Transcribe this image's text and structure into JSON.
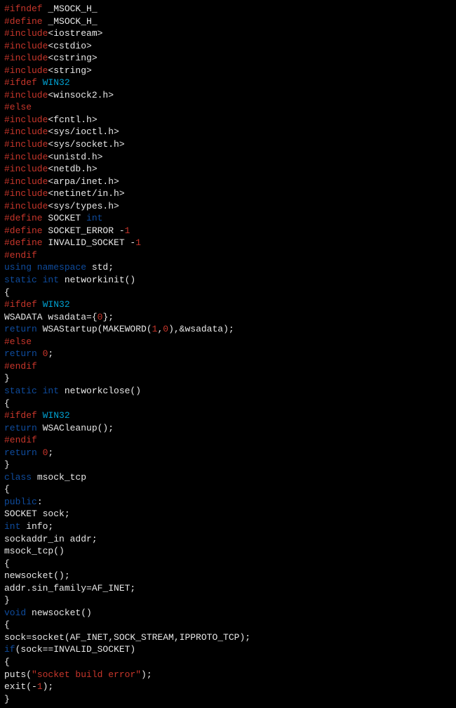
{
  "code": [
    {
      "tokens": [
        {
          "cls": "preproc",
          "t": "#ifndef"
        },
        {
          "cls": "white",
          "t": " _MSOCK_H_"
        }
      ]
    },
    {
      "tokens": [
        {
          "cls": "preproc",
          "t": "#define"
        },
        {
          "cls": "white",
          "t": " _MSOCK_H_"
        }
      ]
    },
    {
      "tokens": [
        {
          "cls": "preproc",
          "t": "#include"
        },
        {
          "cls": "white",
          "t": "<iostream>"
        }
      ]
    },
    {
      "tokens": [
        {
          "cls": "preproc",
          "t": "#include"
        },
        {
          "cls": "white",
          "t": "<cstdio>"
        }
      ]
    },
    {
      "tokens": [
        {
          "cls": "preproc",
          "t": "#include"
        },
        {
          "cls": "white",
          "t": "<cstring>"
        }
      ]
    },
    {
      "tokens": [
        {
          "cls": "preproc",
          "t": "#include"
        },
        {
          "cls": "white",
          "t": "<string>"
        }
      ]
    },
    {
      "tokens": [
        {
          "cls": "preproc",
          "t": "#ifdef"
        },
        {
          "cls": "cyan",
          "t": " WIN32"
        }
      ]
    },
    {
      "tokens": [
        {
          "cls": "preproc",
          "t": "#include"
        },
        {
          "cls": "white",
          "t": "<winsock2.h>"
        }
      ]
    },
    {
      "tokens": [
        {
          "cls": "preproc",
          "t": "#else"
        }
      ]
    },
    {
      "tokens": [
        {
          "cls": "preproc",
          "t": "#include"
        },
        {
          "cls": "white",
          "t": "<fcntl.h>"
        }
      ]
    },
    {
      "tokens": [
        {
          "cls": "preproc",
          "t": "#include"
        },
        {
          "cls": "white",
          "t": "<sys/ioctl.h>"
        }
      ]
    },
    {
      "tokens": [
        {
          "cls": "preproc",
          "t": "#include"
        },
        {
          "cls": "white",
          "t": "<sys/socket.h>"
        }
      ]
    },
    {
      "tokens": [
        {
          "cls": "preproc",
          "t": "#include"
        },
        {
          "cls": "white",
          "t": "<unistd.h>"
        }
      ]
    },
    {
      "tokens": [
        {
          "cls": "preproc",
          "t": "#include"
        },
        {
          "cls": "white",
          "t": "<netdb.h>"
        }
      ]
    },
    {
      "tokens": [
        {
          "cls": "preproc",
          "t": "#include"
        },
        {
          "cls": "white",
          "t": "<arpa/inet.h>"
        }
      ]
    },
    {
      "tokens": [
        {
          "cls": "preproc",
          "t": "#include"
        },
        {
          "cls": "white",
          "t": "<netinet/in.h>"
        }
      ]
    },
    {
      "tokens": [
        {
          "cls": "preproc",
          "t": "#include"
        },
        {
          "cls": "white",
          "t": "<sys/types.h>"
        }
      ]
    },
    {
      "tokens": [
        {
          "cls": "preproc",
          "t": "#define"
        },
        {
          "cls": "white",
          "t": " SOCKET "
        },
        {
          "cls": "keyword",
          "t": "int"
        }
      ]
    },
    {
      "tokens": [
        {
          "cls": "preproc",
          "t": "#define"
        },
        {
          "cls": "white",
          "t": " SOCKET_ERROR -"
        },
        {
          "cls": "number",
          "t": "1"
        }
      ]
    },
    {
      "tokens": [
        {
          "cls": "preproc",
          "t": "#define"
        },
        {
          "cls": "white",
          "t": " INVALID_SOCKET -"
        },
        {
          "cls": "number",
          "t": "1"
        }
      ]
    },
    {
      "tokens": [
        {
          "cls": "preproc",
          "t": "#endif"
        }
      ]
    },
    {
      "tokens": [
        {
          "cls": "keyword",
          "t": "using namespace"
        },
        {
          "cls": "white",
          "t": " std;"
        }
      ]
    },
    {
      "tokens": [
        {
          "cls": "keyword",
          "t": "static int"
        },
        {
          "cls": "white",
          "t": " networkinit()"
        }
      ]
    },
    {
      "tokens": [
        {
          "cls": "white",
          "t": "{"
        }
      ]
    },
    {
      "tokens": [
        {
          "cls": "preproc",
          "t": "#ifdef"
        },
        {
          "cls": "cyan",
          "t": " WIN32"
        }
      ]
    },
    {
      "tokens": [
        {
          "cls": "white",
          "t": "WSADATA wsadata={"
        },
        {
          "cls": "number",
          "t": "0"
        },
        {
          "cls": "white",
          "t": "};"
        }
      ]
    },
    {
      "tokens": [
        {
          "cls": "keyword",
          "t": "return"
        },
        {
          "cls": "white",
          "t": " WSAStartup(MAKEWORD("
        },
        {
          "cls": "number",
          "t": "1"
        },
        {
          "cls": "white",
          "t": ","
        },
        {
          "cls": "number",
          "t": "0"
        },
        {
          "cls": "white",
          "t": "),&wsadata);"
        }
      ]
    },
    {
      "tokens": [
        {
          "cls": "preproc",
          "t": "#else"
        }
      ]
    },
    {
      "tokens": [
        {
          "cls": "keyword",
          "t": "return "
        },
        {
          "cls": "number",
          "t": "0"
        },
        {
          "cls": "white",
          "t": ";"
        }
      ]
    },
    {
      "tokens": [
        {
          "cls": "preproc",
          "t": "#endif"
        }
      ]
    },
    {
      "tokens": [
        {
          "cls": "white",
          "t": "}"
        }
      ]
    },
    {
      "tokens": [
        {
          "cls": "keyword",
          "t": "static int"
        },
        {
          "cls": "white",
          "t": " networkclose()"
        }
      ]
    },
    {
      "tokens": [
        {
          "cls": "white",
          "t": "{"
        }
      ]
    },
    {
      "tokens": [
        {
          "cls": "preproc",
          "t": "#ifdef"
        },
        {
          "cls": "cyan",
          "t": " WIN32"
        }
      ]
    },
    {
      "tokens": [
        {
          "cls": "keyword",
          "t": "return"
        },
        {
          "cls": "white",
          "t": " WSACleanup();"
        }
      ]
    },
    {
      "tokens": [
        {
          "cls": "preproc",
          "t": "#endif"
        }
      ]
    },
    {
      "tokens": [
        {
          "cls": "keyword",
          "t": "return "
        },
        {
          "cls": "number",
          "t": "0"
        },
        {
          "cls": "white",
          "t": ";"
        }
      ]
    },
    {
      "tokens": [
        {
          "cls": "white",
          "t": "}"
        }
      ]
    },
    {
      "tokens": [
        {
          "cls": "keyword",
          "t": "class"
        },
        {
          "cls": "white",
          "t": " msock_tcp"
        }
      ]
    },
    {
      "tokens": [
        {
          "cls": "white",
          "t": "{"
        }
      ]
    },
    {
      "tokens": [
        {
          "cls": "keyword",
          "t": "public"
        },
        {
          "cls": "white",
          "t": ":"
        }
      ]
    },
    {
      "tokens": [
        {
          "cls": "white",
          "t": "SOCKET sock;"
        }
      ]
    },
    {
      "tokens": [
        {
          "cls": "keyword",
          "t": "int"
        },
        {
          "cls": "white",
          "t": " info;"
        }
      ]
    },
    {
      "tokens": [
        {
          "cls": "white",
          "t": "sockaddr_in addr;"
        }
      ]
    },
    {
      "tokens": [
        {
          "cls": "white",
          "t": "msock_tcp()"
        }
      ]
    },
    {
      "tokens": [
        {
          "cls": "white",
          "t": "{"
        }
      ]
    },
    {
      "tokens": [
        {
          "cls": "white",
          "t": "newsocket();"
        }
      ]
    },
    {
      "tokens": [
        {
          "cls": "white",
          "t": "addr.sin_family=AF_INET;"
        }
      ]
    },
    {
      "tokens": [
        {
          "cls": "white",
          "t": "}"
        }
      ]
    },
    {
      "tokens": [
        {
          "cls": "keyword",
          "t": "void"
        },
        {
          "cls": "white",
          "t": " newsocket()"
        }
      ]
    },
    {
      "tokens": [
        {
          "cls": "white",
          "t": "{"
        }
      ]
    },
    {
      "tokens": [
        {
          "cls": "white",
          "t": "sock=socket(AF_INET,SOCK_STREAM,IPPROTO_TCP);"
        }
      ]
    },
    {
      "tokens": [
        {
          "cls": "keyword",
          "t": "if"
        },
        {
          "cls": "white",
          "t": "(sock==INVALID_SOCKET)"
        }
      ]
    },
    {
      "tokens": [
        {
          "cls": "white",
          "t": "{"
        }
      ]
    },
    {
      "tokens": [
        {
          "cls": "white",
          "t": "puts("
        },
        {
          "cls": "string",
          "t": "\"socket build error\""
        },
        {
          "cls": "white",
          "t": ");"
        }
      ]
    },
    {
      "tokens": [
        {
          "cls": "white",
          "t": "exit(-"
        },
        {
          "cls": "number",
          "t": "1"
        },
        {
          "cls": "white",
          "t": ");"
        }
      ]
    },
    {
      "tokens": [
        {
          "cls": "white",
          "t": "}"
        }
      ]
    }
  ]
}
